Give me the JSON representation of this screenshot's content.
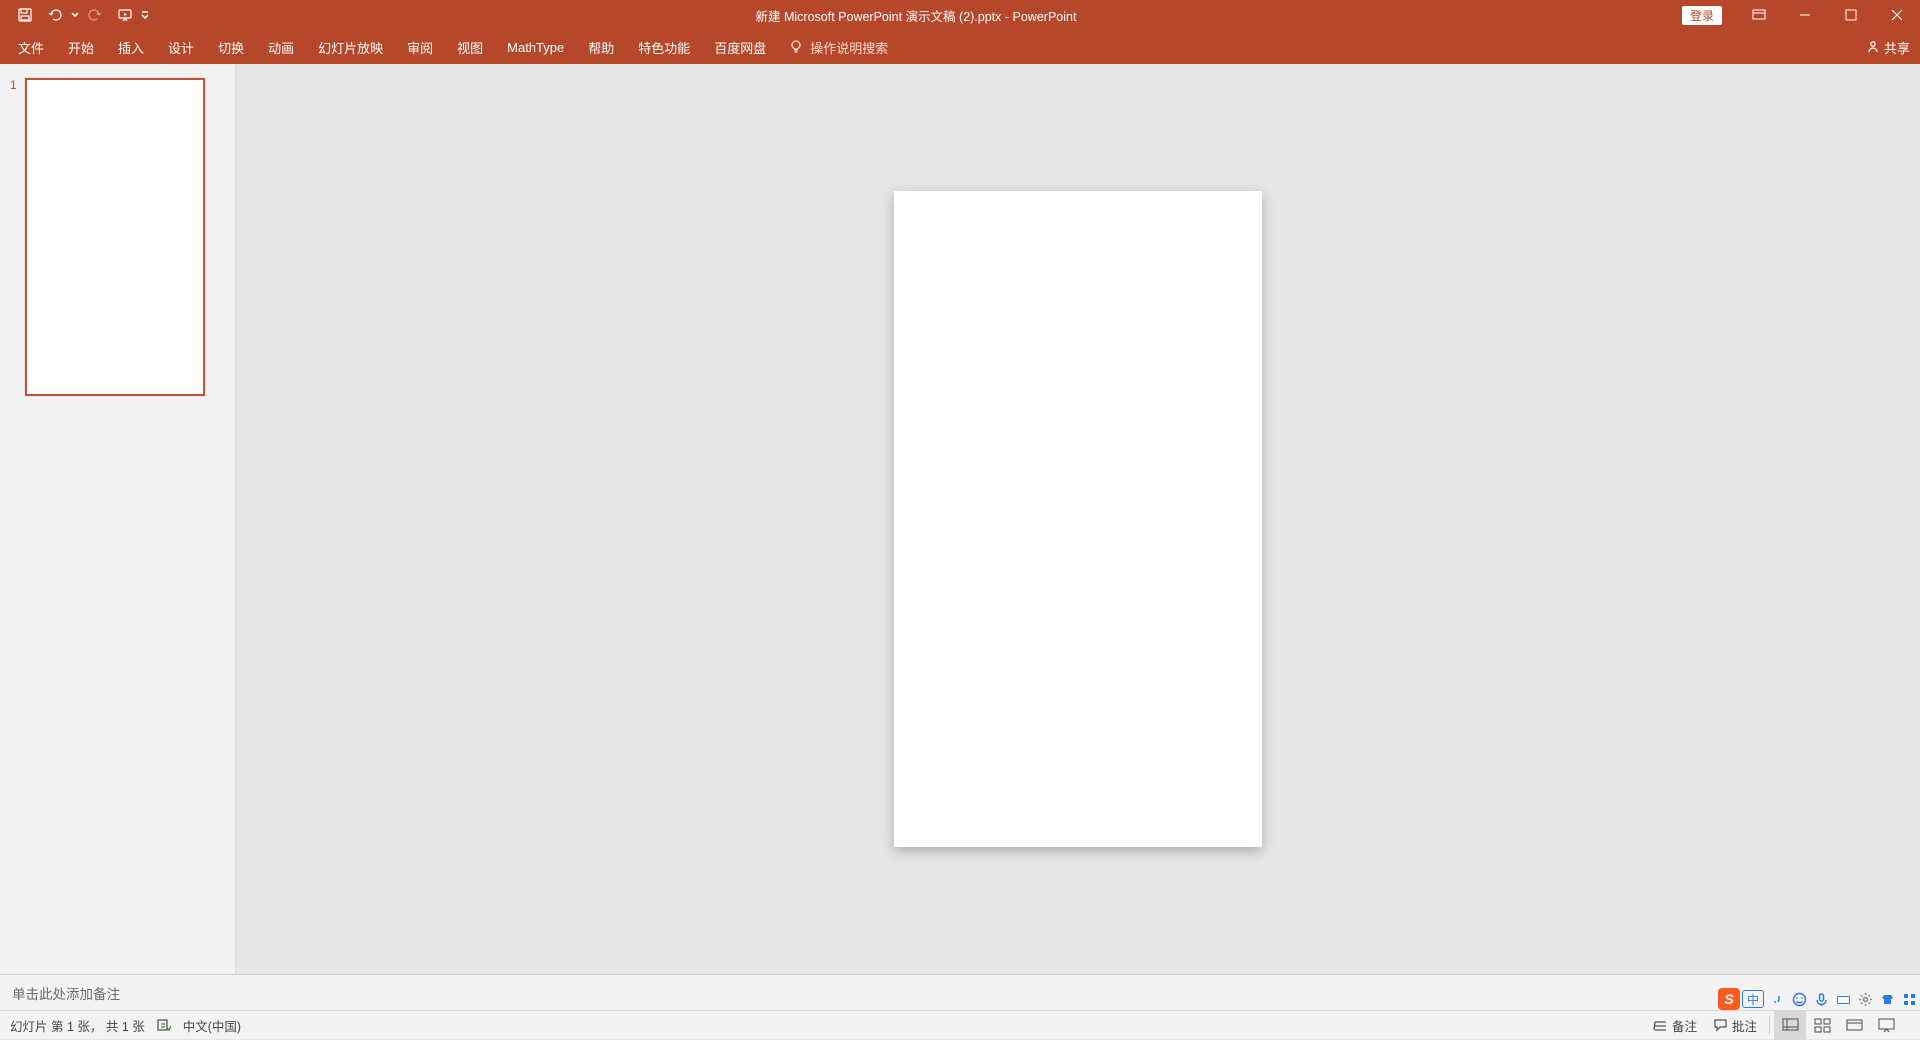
{
  "titlebar": {
    "document_title": "新建 Microsoft PowerPoint 演示文稿 (2).pptx  -  PowerPoint",
    "login_label": "登录"
  },
  "ribbon": {
    "tabs": [
      "文件",
      "开始",
      "插入",
      "设计",
      "切换",
      "动画",
      "幻灯片放映",
      "审阅",
      "视图",
      "MathType",
      "帮助",
      "特色功能",
      "百度网盘"
    ],
    "tellme": "操作说明搜索",
    "share": "共享"
  },
  "thumbnail": {
    "number": "1"
  },
  "notes": {
    "placeholder": "单击此处添加备注"
  },
  "statusbar": {
    "slide_indicator": "幻灯片 第 1 张， 共 1 张",
    "language": "中文(中国)",
    "notes_label": "备注",
    "comments_label": "批注"
  },
  "ime": {
    "product_letter": "S",
    "lang_label": "中"
  }
}
